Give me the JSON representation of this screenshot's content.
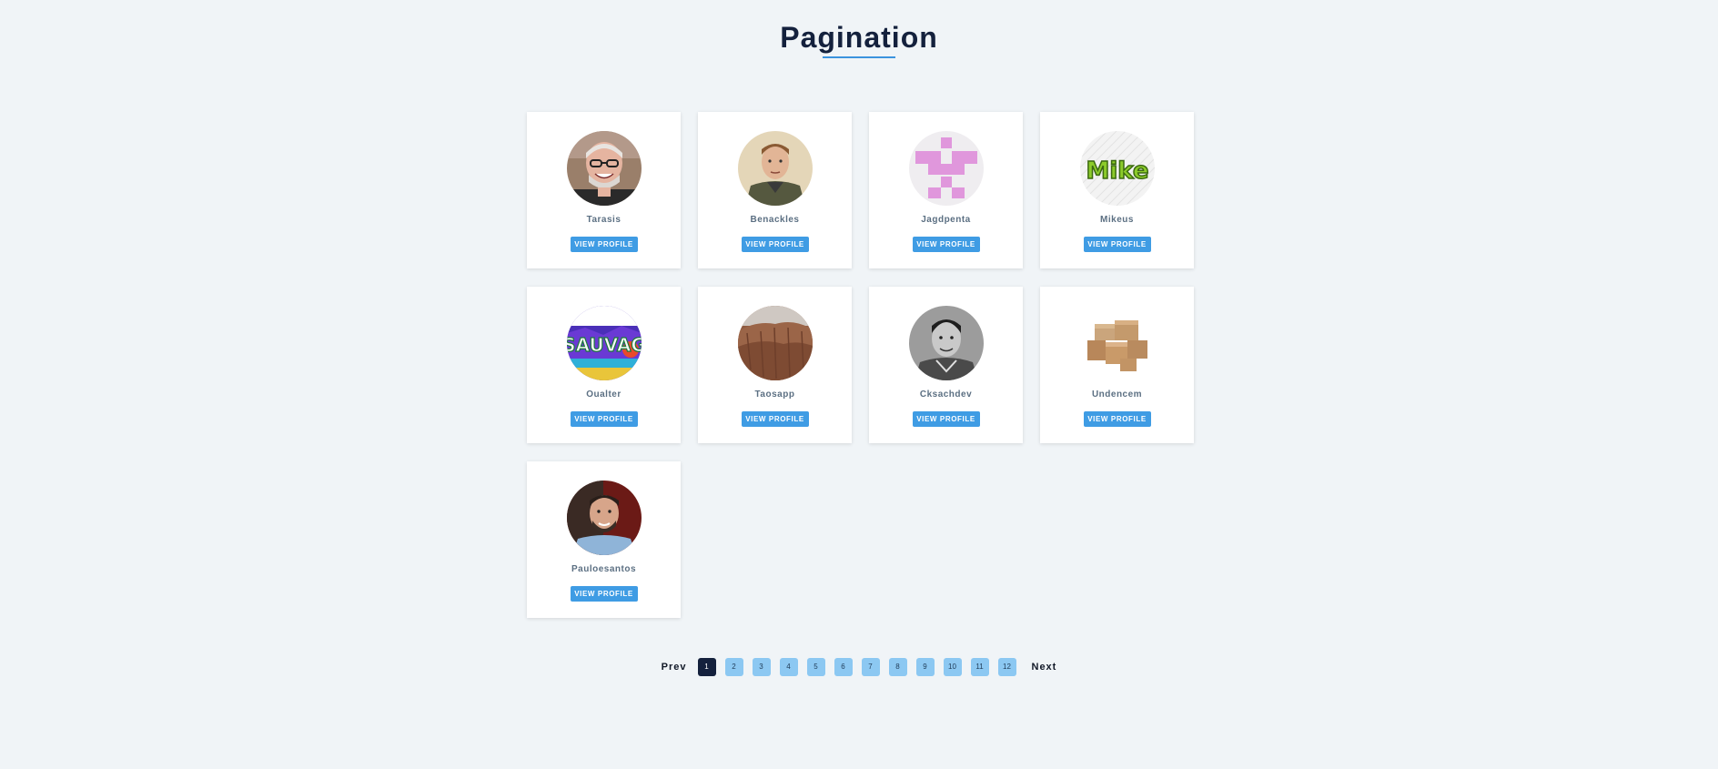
{
  "page": {
    "title": "Pagination"
  },
  "cards": [
    {
      "name": "Tarasis",
      "button": "VIEW PROFILE",
      "avatar": "photo-gray-haired-man-glasses"
    },
    {
      "name": "Benackles",
      "button": "VIEW PROFILE",
      "avatar": "photo-young-man"
    },
    {
      "name": "Jagdpenta",
      "button": "VIEW PROFILE",
      "avatar": "pink-pixel-identicon"
    },
    {
      "name": "Mikeus",
      "button": "VIEW PROFILE",
      "avatar": "mike-logo"
    },
    {
      "name": "Oualter",
      "button": "VIEW PROFILE",
      "avatar": "sauvag-graffiti"
    },
    {
      "name": "Taosapp",
      "button": "VIEW PROFILE",
      "avatar": "rocky-hills-photo"
    },
    {
      "name": "Cksachdev",
      "button": "VIEW PROFILE",
      "avatar": "photo-man-bw"
    },
    {
      "name": "Undencem",
      "button": "VIEW PROFILE",
      "avatar": "cardboard-boxes"
    },
    {
      "name": "Pauloesantos",
      "button": "VIEW PROFILE",
      "avatar": "photo-bearded-man"
    }
  ],
  "pagination": {
    "prev_label": "Prev",
    "next_label": "Next",
    "pages": [
      "1",
      "2",
      "3",
      "4",
      "5",
      "6",
      "7",
      "8",
      "9",
      "10",
      "11",
      "12"
    ],
    "current": "1"
  },
  "colors": {
    "background": "#f0f4f7",
    "title": "#14213d",
    "accent": "#3b93de",
    "button": "#3f9ce4",
    "page_inactive": "#8cc8f2",
    "page_active": "#14213d"
  }
}
